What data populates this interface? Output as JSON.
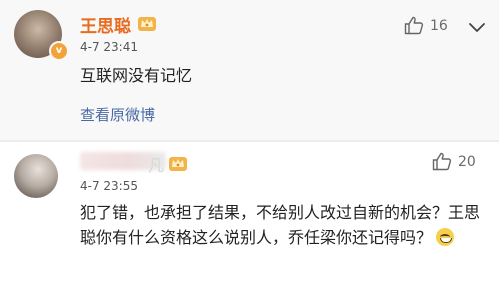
{
  "comments": [
    {
      "author": "王思聪",
      "time": "4-7 23:41",
      "text": "互联网没有记忆",
      "likes": "16",
      "view_original": "查看原微博",
      "badge": "v"
    },
    {
      "time": "4-7 23:55",
      "text": "犯了错，也承担了结果，不给别人改过自新的机会？王思聪你有什么资格这么说别人，乔任梁你还记得吗？",
      "likes": "20"
    }
  ],
  "icons": {
    "like": "thumbs-up-icon",
    "more": "more-icon",
    "vip": "crown-icon",
    "emoji": "smile-emoji-icon"
  },
  "colors": {
    "author_name": "#e86b1f",
    "link": "#4a6aa5",
    "badge": "#f3a23a"
  }
}
